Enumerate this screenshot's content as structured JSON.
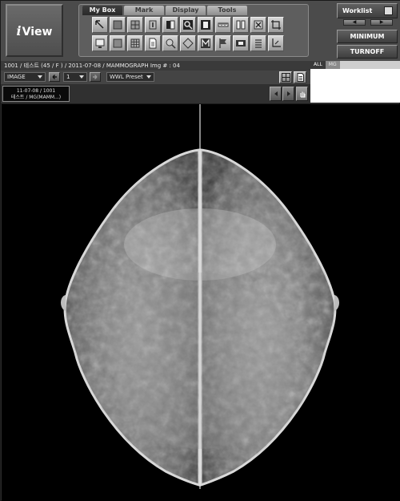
{
  "app": {
    "logo_text": "View",
    "logo_prefix": "i"
  },
  "tool_tabs": [
    "My Box",
    "Mark",
    "Display",
    "Tools"
  ],
  "tool_buttons_row1": [
    "pointer-icon",
    "window-icon",
    "grid-icon",
    "info-icon",
    "invert-icon",
    "magnify-icon",
    "pdf-icon",
    "ruler-icon",
    "compare-icon",
    "delete-icon",
    "crop-icon"
  ],
  "tool_buttons_row2": [
    "monitor-icon",
    "layout-icon",
    "tile-icon",
    "document-icon",
    "zoom-icon",
    "rotate-icon",
    "mark-icon",
    "flag-icon",
    "export-icon",
    "list-icon",
    "axis-icon"
  ],
  "right_panel": {
    "worklist": "Worklist",
    "minimum": "MINIMUM",
    "turnoff": "TURNOFF"
  },
  "info_bar": "1001 / 테스트 (45 / F ) / 2011-07-08 / MAMMOGRAPH     Img # : 04",
  "controls": {
    "mode": "IMAGE",
    "page": "1",
    "wwl": "WWL Preset"
  },
  "right_tabs": [
    "ALL",
    "MG"
  ],
  "series_thumb": {
    "line1": "11-07-08 / 1001",
    "line2": "테스트 / MG(MAMM...)"
  },
  "colors": {
    "toolbar_bg": "#4b4b4b",
    "panel_bg": "#5e5e5e",
    "viewer_bg": "#000000"
  }
}
